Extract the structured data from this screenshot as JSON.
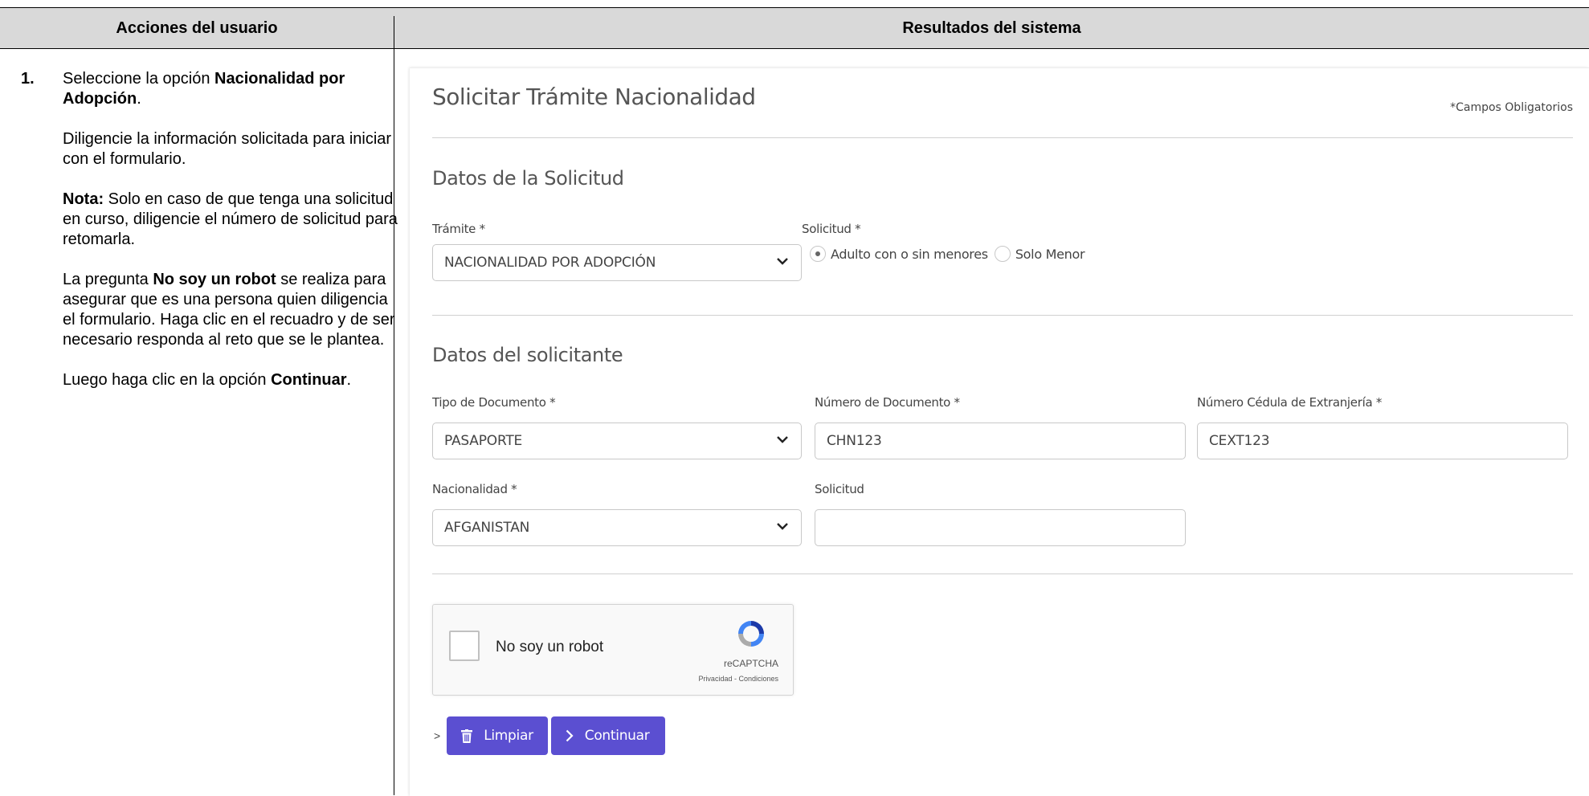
{
  "table": {
    "header_left": "Acciones del usuario",
    "header_right": "Resultados del sistema"
  },
  "instructions": {
    "step_number": "1.",
    "p1_pre": "Seleccione la opción ",
    "p1_bold": "Nacionalidad por Adopción",
    "p1_post": ".",
    "p2": "Diligencie la información solicitada para iniciar con el formulario.",
    "p3_bold": "Nota:",
    "p3_text": " Solo en caso de que tenga una solicitud en curso, diligencie el número de solicitud para retomarla.",
    "p4_pre": "La pregunta ",
    "p4_bold": "No soy un robot",
    "p4_text": " se realiza para asegurar que es una persona quien diligencia el formulario. Haga clic en el recuadro y de ser necesario responda al reto que se le plantea.",
    "p5_pre": "Luego haga clic en la opción ",
    "p5_bold": "Continuar",
    "p5_post": "."
  },
  "form": {
    "title": "Solicitar Trámite Nacionalidad",
    "required_note": "*Campos Obligatorios",
    "section1_title": "Datos de la Solicitud",
    "tramite_label": "Trámite *",
    "tramite_value": "NACIONALIDAD POR ADOPCIÓN",
    "solicitud_label": "Solicitud *",
    "radio_options": [
      "Adulto con o sin menores",
      "Solo Menor"
    ],
    "radio_selected": "Adulto con o sin menores",
    "section2_title": "Datos del solicitante",
    "tipo_doc_label": "Tipo de Documento *",
    "tipo_doc_value": "PASAPORTE",
    "num_doc_label": "Número de Documento *",
    "num_doc_value": "CHN123",
    "cedula_ext_label": "Número Cédula de Extranjería *",
    "cedula_ext_value": "CEXT123",
    "nacionalidad_label": "Nacionalidad *",
    "nacionalidad_value": "AFGANISTAN",
    "solicitud_num_label": "Solicitud",
    "solicitud_num_value": ""
  },
  "captcha": {
    "label": "No soy un robot",
    "brand": "reCAPTCHA",
    "terms": "Privacidad - Condiciones"
  },
  "buttons": {
    "caret": ">",
    "clear": "Limpiar",
    "continue": "Continuar"
  },
  "colors": {
    "button": "#5b4fd1",
    "header_bg": "#d9d9d9"
  }
}
